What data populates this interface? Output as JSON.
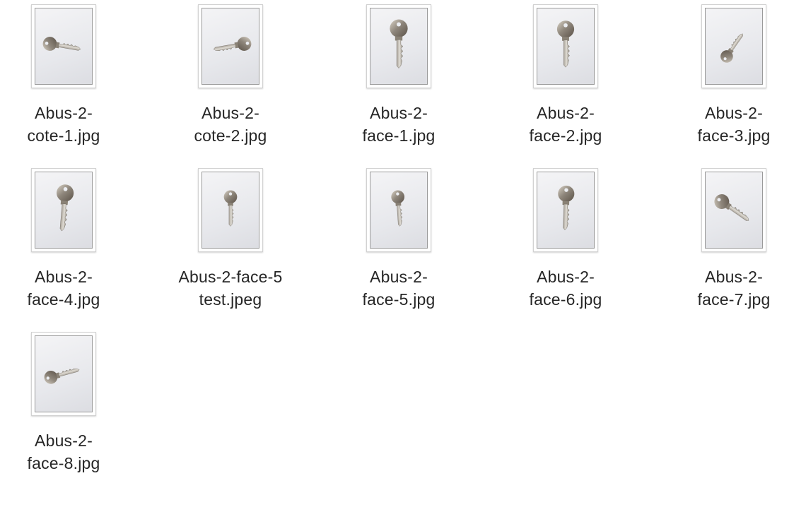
{
  "files": [
    {
      "line1": "Abus-2-",
      "line2": "cote-1.jpg",
      "icon": "key-photo-icon",
      "key": {
        "angle": -80,
        "scale": 0.9
      }
    },
    {
      "line1": "Abus-2-",
      "line2": "cote-2.jpg",
      "icon": "key-photo-icon",
      "key": {
        "angle": 80,
        "scale": 0.9
      }
    },
    {
      "line1": "Abus-2-",
      "line2": "face-1.jpg",
      "icon": "key-photo-icon",
      "key": {
        "angle": 0,
        "scale": 1.15
      }
    },
    {
      "line1": "Abus-2-",
      "line2": "face-2.jpg",
      "icon": "key-photo-icon",
      "key": {
        "angle": 0,
        "scale": 1.1
      }
    },
    {
      "line1": "Abus-2-",
      "line2": "face-3.jpg",
      "icon": "key-photo-icon",
      "key": {
        "angle": 215,
        "scale": 0.8
      }
    },
    {
      "line1": "Abus-2-",
      "line2": "face-4.jpg",
      "icon": "key-photo-icon",
      "key": {
        "angle": 5,
        "scale": 1.1
      }
    },
    {
      "line1": "Abus-2-face-5",
      "line2": "test.jpeg",
      "icon": "key-photo-icon",
      "key": {
        "angle": 0,
        "scale": 0.85
      }
    },
    {
      "line1": "Abus-2-",
      "line2": "face-5.jpg",
      "icon": "key-photo-icon",
      "key": {
        "angle": -4,
        "scale": 0.85
      }
    },
    {
      "line1": "Abus-2-",
      "line2": "face-6.jpg",
      "icon": "key-photo-icon",
      "key": {
        "angle": 2,
        "scale": 1.05
      }
    },
    {
      "line1": "Abus-2-",
      "line2": "face-7.jpg",
      "icon": "key-photo-icon",
      "key": {
        "angle": -55,
        "scale": 0.95
      }
    },
    {
      "line1": "Abus-2-",
      "line2": "face-8.jpg",
      "icon": "key-photo-icon",
      "key": {
        "angle": -105,
        "scale": 0.85
      }
    }
  ]
}
